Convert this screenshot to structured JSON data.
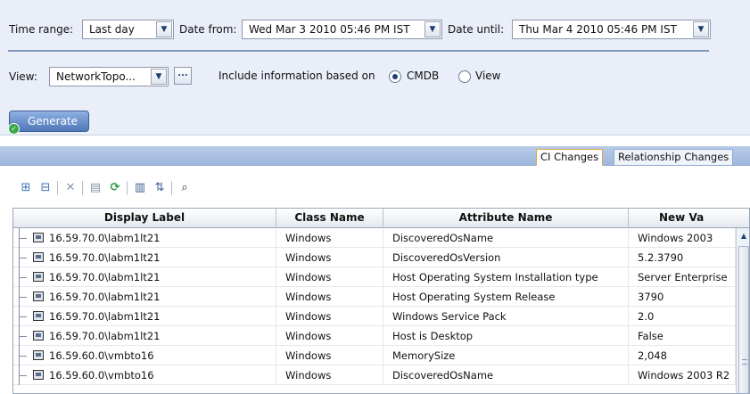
{
  "filters": {
    "time_range_label": "Time range:",
    "time_range_value": "Last day",
    "date_from_label": "Date from:",
    "date_from_value": "Wed Mar 3 2010 05:46 PM IST",
    "date_until_label": "Date until:",
    "date_until_value": "Thu Mar 4 2010 05:46 PM IST",
    "view_label": "View:",
    "view_value": "NetworkTopo...",
    "view_browse": "...",
    "include_label": "Include information based on",
    "radio_cmdb": "CMDB",
    "radio_view": "View",
    "selected_source": "CMDB",
    "generate_label": "Generate"
  },
  "tabs": [
    {
      "label": "CI Changes",
      "active": true
    },
    {
      "label": "Relationship Changes",
      "active": false
    }
  ],
  "toolbar_icons": [
    "expand-all-icon",
    "collapse-all-icon",
    "delete-icon",
    "properties-icon",
    "refresh-icon",
    "columns-icon",
    "sort-icon",
    "find-icon"
  ],
  "table": {
    "columns": [
      "Display Label",
      "Class Name",
      "Attribute Name",
      "New Va"
    ],
    "rows": [
      [
        "16.59.70.0\\labm1lt21",
        "Windows",
        "DiscoveredOsName",
        "Windows 2003"
      ],
      [
        "16.59.70.0\\labm1lt21",
        "Windows",
        "DiscoveredOsVersion",
        "5.2.3790"
      ],
      [
        "16.59.70.0\\labm1lt21",
        "Windows",
        "Host Operating System Installation type",
        "Server Enterprise"
      ],
      [
        "16.59.70.0\\labm1lt21",
        "Windows",
        "Host Operating System Release",
        "3790"
      ],
      [
        "16.59.70.0\\labm1lt21",
        "Windows",
        "Windows Service Pack",
        "2.0"
      ],
      [
        "16.59.70.0\\labm1lt21",
        "Windows",
        "Host is Desktop",
        "False"
      ],
      [
        "16.59.60.0\\vmbto16",
        "Windows",
        "MemorySize",
        "2,048"
      ],
      [
        "16.59.60.0\\vmbto16",
        "Windows",
        "DiscoveredOsName",
        "Windows 2003 R2"
      ]
    ]
  }
}
